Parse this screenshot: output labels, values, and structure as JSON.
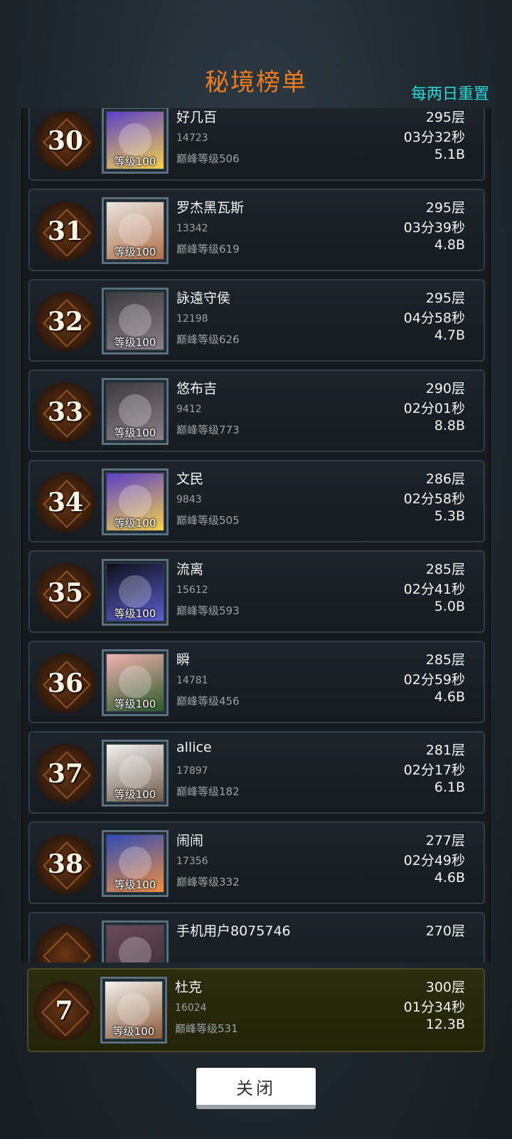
{
  "header": {
    "title": "秘境榜单",
    "reset_note": "每两日重置"
  },
  "rows": [
    {
      "rank": "30",
      "name": "好几百",
      "id": "14723",
      "level": "等级100",
      "peak": "巅峰等级506",
      "floor": "295层",
      "time": "03分32秒",
      "power": "5.1B",
      "avatar_color": "#5a3fc8",
      "avatar_accent": "#f6d24a"
    },
    {
      "rank": "31",
      "name": "罗杰黑瓦斯",
      "id": "13342",
      "level": "等级100",
      "peak": "巅峰等级619",
      "floor": "295层",
      "time": "03分39秒",
      "power": "4.8B",
      "avatar_color": "#e9e4e0",
      "avatar_accent": "#b0704a"
    },
    {
      "rank": "32",
      "name": "詠遠守侯",
      "id": "12198",
      "level": "等级100",
      "peak": "巅峰等级626",
      "floor": "295层",
      "time": "04分58秒",
      "power": "4.7B",
      "avatar_color": "#3d3a3f",
      "avatar_accent": "#8a8088"
    },
    {
      "rank": "33",
      "name": "悠布吉",
      "id": "9412",
      "level": "等级100",
      "peak": "巅峰等级773",
      "floor": "290层",
      "time": "02分01秒",
      "power": "8.8B",
      "avatar_color": "#3d3a3f",
      "avatar_accent": "#8a8088"
    },
    {
      "rank": "34",
      "name": "文民",
      "id": "9843",
      "level": "等级100",
      "peak": "巅峰等级505",
      "floor": "286层",
      "time": "02分58秒",
      "power": "5.3B",
      "avatar_color": "#5a3fc8",
      "avatar_accent": "#f6d24a"
    },
    {
      "rank": "35",
      "name": "流离",
      "id": "15612",
      "level": "等级100",
      "peak": "巅峰等级593",
      "floor": "285层",
      "time": "02分41秒",
      "power": "5.0B",
      "avatar_color": "#0d0f18",
      "avatar_accent": "#5a5fd0"
    },
    {
      "rank": "36",
      "name": "瞬",
      "id": "14781",
      "level": "等级100",
      "peak": "巅峰等级456",
      "floor": "285层",
      "time": "02分59秒",
      "power": "4.6B",
      "avatar_color": "#f2b3b0",
      "avatar_accent": "#2a5a2c"
    },
    {
      "rank": "37",
      "name": "allice",
      "id": "17897",
      "level": "等级100",
      "peak": "巅峰等级182",
      "floor": "281层",
      "time": "02分17秒",
      "power": "6.1B",
      "avatar_color": "#f4f2f0",
      "avatar_accent": "#6e5a4a"
    },
    {
      "rank": "38",
      "name": "闹闹",
      "id": "17356",
      "level": "等级100",
      "peak": "巅峰等级332",
      "floor": "277层",
      "time": "02分49秒",
      "power": "4.6B",
      "avatar_color": "#2f4bb8",
      "avatar_accent": "#f09040"
    },
    {
      "rank": "",
      "name": "手机用户8075746",
      "id": "",
      "level": "",
      "peak": "",
      "floor": "270层",
      "time": "",
      "power": "",
      "avatar_color": "#6a4a5a",
      "avatar_accent": "#3a2a30"
    }
  ],
  "self_row": {
    "rank": "7",
    "name": "杜克",
    "id": "16024",
    "level": "等级100",
    "peak": "巅峰等级531",
    "floor": "300层",
    "time": "01分34秒",
    "power": "12.3B",
    "avatar_color": "#f4f2ee",
    "avatar_accent": "#8a5a3a"
  },
  "footer": {
    "close_label": "关闭"
  }
}
